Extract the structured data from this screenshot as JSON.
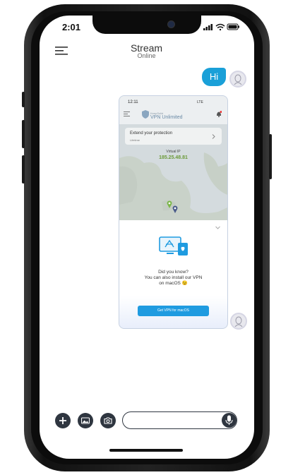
{
  "status_bar": {
    "time": "2:01"
  },
  "header": {
    "title": "Stream",
    "status": "Online"
  },
  "messages": [
    {
      "from": "me",
      "text": "Hi"
    },
    {
      "from": "me",
      "type": "image",
      "screenshot": {
        "time": "12:11",
        "status": "LTE",
        "brand": "KeepSolid",
        "app_name": "VPN Unlimited",
        "card_title": "Extend your protection",
        "card_subtitle": "Lifetime",
        "ip_label": "Virtual IP",
        "ip_value": "185.25.48.81",
        "dyk_line1": "Did you know?",
        "dyk_line2": "You can also install our VPN",
        "dyk_line3": "on macOS 😉",
        "button_label": "Get VPN for macOS"
      }
    }
  ],
  "colors": {
    "accent": "#1aa0d8",
    "button": "#1f9be0",
    "dark": "#2f3640",
    "ip_green": "#6c9a3a"
  },
  "icons": [
    "menu-icon",
    "plus-icon",
    "image-icon",
    "camera-icon",
    "mic-icon",
    "avatar-icon"
  ]
}
